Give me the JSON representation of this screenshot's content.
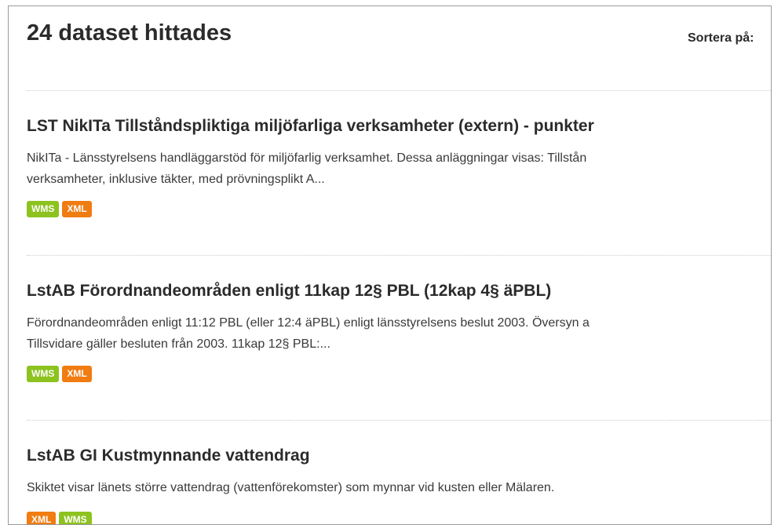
{
  "header": {
    "result_count": "24 dataset hittades",
    "sort_label": "Sortera på:"
  },
  "colors": {
    "wms_badge": "#8dc21f",
    "xml_badge": "#f07c12"
  },
  "results": [
    {
      "title": "LST NikITa Tillståndspliktiga miljöfarliga verksamheter (extern) - punkter",
      "desc_line1": "NikITa - Länsstyrelsens handläggarstöd för miljöfarlig verksamhet. Dessa anläggningar visas: Tillstån",
      "desc_line2": "verksamheter, inklusive täkter, med prövningsplikt A...",
      "badges": [
        "WMS",
        "XML"
      ]
    },
    {
      "title": "LstAB Förordnandeområden enligt 11kap 12§ PBL (12kap 4§ äPBL)",
      "desc_line1": "Förordnandeområden enligt 11:12 PBL (eller 12:4 äPBL) enligt länsstyrelsens beslut 2003. Översyn a",
      "desc_line2": "Tillsvidare gäller besluten från 2003. 11kap 12§ PBL:...",
      "badges": [
        "WMS",
        "XML"
      ]
    },
    {
      "title": "LstAB GI Kustmynnande vattendrag",
      "desc_line1": "Skiktet visar länets större vattendrag (vattenförekomster) som mynnar vid kusten eller Mälaren.",
      "desc_line2": "",
      "badges": [
        "XML",
        "WMS"
      ]
    }
  ]
}
